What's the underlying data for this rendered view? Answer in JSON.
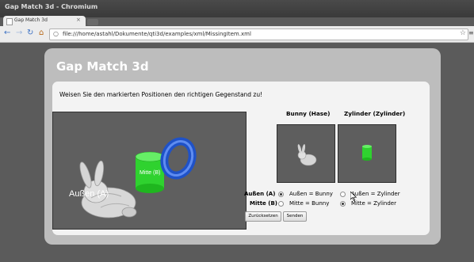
{
  "window": {
    "title": "Gap Match 3d - Chromium"
  },
  "tab": {
    "title": "Gap Match 3d",
    "close": "×"
  },
  "toolbar": {
    "back": "←",
    "forward": "→",
    "reload": "↻",
    "home": "⌂",
    "url": "file:///home/astahl/Dokumente/qti3d/examples/xml/MissingItem.xml",
    "bookmark": "☆",
    "menu": "≡"
  },
  "page": {
    "heading": "Gap Match 3d",
    "prompt": "Weisen Sie den markierten Positionen den richtigen Gegenstand zu!",
    "scene_labels": {
      "outer": "Außen (A)",
      "middle": "Mitte (B)"
    },
    "columns": [
      {
        "header": "Bunny (Hase)"
      },
      {
        "header": "Zylinder (Zylinder)"
      }
    ],
    "rows": [
      {
        "label": "Außen (A)",
        "options": [
          "Außen = Bunny",
          "Außen = Zylinder"
        ],
        "selected": [
          true,
          false
        ]
      },
      {
        "label": "Mitte (B)",
        "options": [
          "Mitte = Bunny",
          "Mitte = Zylinder"
        ],
        "selected": [
          false,
          true
        ]
      }
    ],
    "buttons": {
      "reset": "Zurücksetzen",
      "submit": "Senden"
    }
  },
  "icons": [
    "back-arrow-icon",
    "forward-arrow-icon",
    "reload-icon",
    "home-icon",
    "page-icon",
    "star-icon",
    "wrench-icon",
    "cursor-icon"
  ]
}
